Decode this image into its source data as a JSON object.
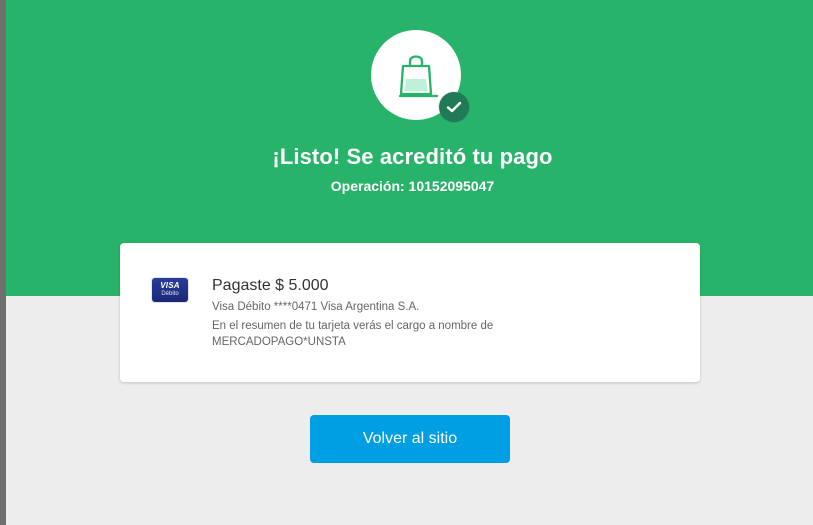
{
  "result": {
    "title": "¡Listo! Se acreditó tu pago",
    "operation": "Operación: 10152095047",
    "hero_color": "#28b36a"
  },
  "payment": {
    "card_brand": "VISA",
    "card_type": "Débito",
    "summary": "Pagaste $ 5.000",
    "method": "Visa Débito ****0471 Visa Argentina S.A.",
    "statement_line1": "En el resumen de tu tarjeta verás el cargo a nombre de",
    "statement_line2": "MERCADOPAGO*UNSTA"
  },
  "actions": {
    "return_label": "Volver al sitio",
    "button_color": "#009ee3"
  },
  "icons": {
    "hero_icon": "shopping-bag-icon",
    "badge_icon": "check-icon",
    "card_icon": "visa-card-icon"
  }
}
